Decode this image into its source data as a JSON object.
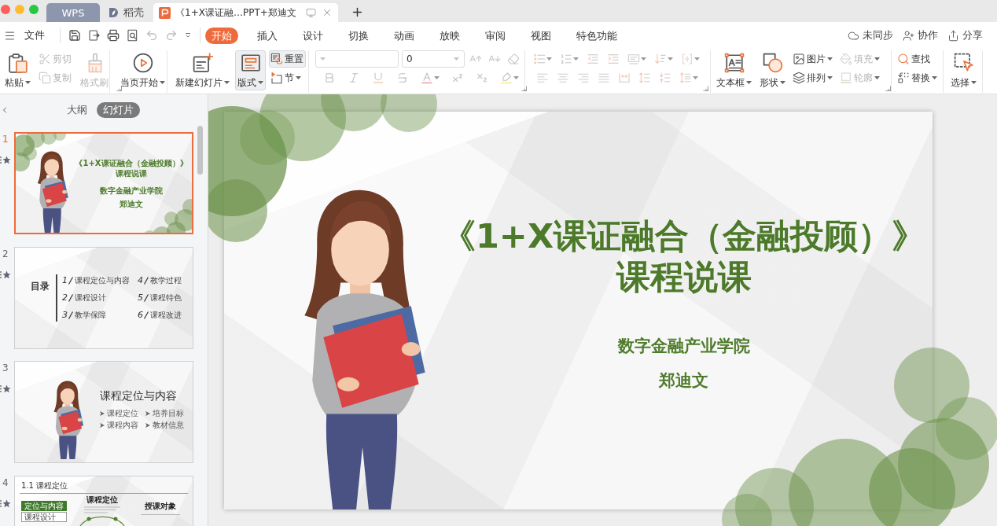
{
  "tabs": [
    {
      "kind": "home",
      "label": "WPS",
      "selected": false
    },
    {
      "kind": "store",
      "label": "稻壳",
      "selected": false
    },
    {
      "kind": "document",
      "label": "《1+X课证融…PPT+郑迪文",
      "selected": true
    }
  ],
  "file_menu": {
    "label": "文件"
  },
  "quick_access": [
    {
      "disabled": false
    },
    {
      "disabled": false
    },
    {
      "disabled": false
    },
    {
      "disabled": false
    },
    {
      "disabled": true
    },
    {
      "disabled": true
    },
    {
      "disabled": false
    }
  ],
  "menu_tabs": [
    {
      "label": "开始",
      "selected": true
    },
    {
      "label": "插入",
      "selected": false
    },
    {
      "label": "设计",
      "selected": false
    },
    {
      "label": "切换",
      "selected": false
    },
    {
      "label": "动画",
      "selected": false
    },
    {
      "label": "放映",
      "selected": false
    },
    {
      "label": "审阅",
      "selected": false
    },
    {
      "label": "视图",
      "selected": false
    },
    {
      "label": "特色功能",
      "selected": false
    }
  ],
  "account_actions": [
    {
      "label": "未同步"
    },
    {
      "label": "协作"
    },
    {
      "label": "分享"
    }
  ],
  "ribbon": [
    {
      "kind": "columns",
      "launcher": true,
      "columns": [
        [
          {
            "kind": "large",
            "label": "粘贴",
            "dropdown": true,
            "disabled": false,
            "highlighted": false
          }
        ],
        [
          {
            "kind": "small",
            "label": "剪切",
            "dropdown": false,
            "disabled": true,
            "highlighted": false
          },
          {
            "kind": "small",
            "label": "复制",
            "dropdown": false,
            "disabled": true,
            "highlighted": false
          }
        ],
        [
          {
            "kind": "large",
            "label": "格式刷",
            "dropdown": false,
            "disabled": true,
            "highlighted": false
          }
        ]
      ]
    },
    {
      "kind": "columns",
      "launcher": false,
      "columns": [
        [
          {
            "kind": "large",
            "label": "当页开始",
            "dropdown": true,
            "disabled": false,
            "highlighted": false
          }
        ]
      ]
    },
    {
      "kind": "columns",
      "launcher": false,
      "columns": [
        [
          {
            "kind": "large",
            "label": "新建幻灯片",
            "dropdown": true,
            "disabled": false,
            "highlighted": false
          }
        ],
        [
          {
            "kind": "large",
            "label": "版式",
            "dropdown": true,
            "disabled": false,
            "highlighted": true
          }
        ],
        [
          {
            "kind": "small",
            "label": "重置",
            "dropdown": false,
            "disabled": false,
            "highlighted": true
          },
          {
            "kind": "small",
            "label": "节",
            "dropdown": true,
            "disabled": false,
            "highlighted": false
          }
        ]
      ]
    },
    {
      "kind": "rows",
      "launcher": true,
      "rows": [
        [
          {
            "kind": "combo",
            "dropdown": true,
            "disabled": false,
            "highlighted": false
          },
          {
            "kind": "combo",
            "value": "0",
            "dropdown": true,
            "disabled": false,
            "highlighted": false
          },
          {
            "kind": "icon",
            "dropdown": false,
            "disabled": true,
            "highlighted": false
          },
          {
            "kind": "icon",
            "dropdown": false,
            "disabled": true,
            "highlighted": false
          },
          {
            "kind": "icon",
            "dropdown": false,
            "disabled": true,
            "highlighted": false
          }
        ],
        [
          {
            "kind": "icon",
            "dropdown": false,
            "disabled": true,
            "highlighted": false
          },
          {
            "kind": "icon",
            "dropdown": false,
            "disabled": true,
            "highlighted": false
          },
          {
            "kind": "icon",
            "dropdown": false,
            "disabled": true,
            "highlighted": false
          },
          {
            "kind": "icon",
            "dropdown": false,
            "disabled": true,
            "highlighted": false
          },
          {
            "kind": "icon",
            "dropdown": true,
            "disabled": true,
            "highlighted": false
          },
          {
            "kind": "icon",
            "dropdown": false,
            "disabled": true,
            "highlighted": false
          },
          {
            "kind": "icon",
            "dropdown": false,
            "disabled": true,
            "highlighted": false
          },
          {
            "kind": "icon",
            "dropdown": true,
            "disabled": true,
            "highlighted": false
          }
        ]
      ]
    },
    {
      "kind": "rows",
      "launcher": true,
      "rows": [
        [
          {
            "kind": "icon",
            "dropdown": true,
            "disabled": true,
            "highlighted": false
          },
          {
            "kind": "icon",
            "dropdown": true,
            "disabled": true,
            "highlighted": false
          },
          {
            "kind": "icon",
            "dropdown": false,
            "disabled": true,
            "highlighted": false
          },
          {
            "kind": "icon",
            "dropdown": false,
            "disabled": true,
            "highlighted": false
          },
          {
            "kind": "icon",
            "dropdown": true,
            "disabled": true,
            "highlighted": false
          },
          {
            "kind": "icon",
            "dropdown": true,
            "disabled": true,
            "highlighted": false
          },
          {
            "kind": "icon",
            "dropdown": true,
            "disabled": true,
            "highlighted": false
          }
        ],
        [
          {
            "kind": "icon",
            "dropdown": false,
            "disabled": true,
            "highlighted": false
          },
          {
            "kind": "icon",
            "dropdown": false,
            "disabled": true,
            "highlighted": false
          },
          {
            "kind": "icon",
            "dropdown": false,
            "disabled": true,
            "highlighted": false
          },
          {
            "kind": "icon",
            "dropdown": false,
            "disabled": true,
            "highlighted": false
          },
          {
            "kind": "icon",
            "dropdown": false,
            "disabled": true,
            "highlighted": false
          },
          {
            "kind": "icon",
            "dropdown": false,
            "disabled": true,
            "highlighted": false
          },
          {
            "kind": "icon",
            "dropdown": false,
            "disabled": true,
            "highlighted": false
          },
          {
            "kind": "icon",
            "dropdown": true,
            "disabled": true,
            "highlighted": false
          }
        ]
      ]
    },
    {
      "kind": "columns",
      "launcher": true,
      "columns": [
        [
          {
            "kind": "large",
            "label": "文本框",
            "dropdown": true,
            "disabled": false,
            "highlighted": false
          }
        ],
        [
          {
            "kind": "large",
            "label": "形状",
            "dropdown": true,
            "disabled": false,
            "highlighted": false
          }
        ],
        [
          {
            "kind": "small",
            "label": "图片",
            "dropdown": true,
            "disabled": false,
            "highlighted": false
          },
          {
            "kind": "small",
            "label": "排列",
            "dropdown": true,
            "disabled": false,
            "highlighted": false
          }
        ],
        [
          {
            "kind": "small",
            "label": "填充",
            "dropdown": true,
            "disabled": true,
            "highlighted": false
          },
          {
            "kind": "small",
            "label": "轮廓",
            "dropdown": true,
            "disabled": true,
            "highlighted": false
          }
        ]
      ]
    },
    {
      "kind": "columns",
      "launcher": false,
      "columns": [
        [
          {
            "kind": "small",
            "label": "查找",
            "dropdown": false,
            "disabled": false,
            "highlighted": false
          },
          {
            "kind": "small",
            "label": "替换",
            "dropdown": true,
            "disabled": false,
            "highlighted": false
          }
        ]
      ]
    },
    {
      "kind": "columns",
      "launcher": false,
      "columns": [
        [
          {
            "kind": "large",
            "label": "选择",
            "dropdown": true,
            "disabled": false,
            "highlighted": false
          }
        ]
      ]
    }
  ],
  "outline_tabs": [
    {
      "label": "大纲",
      "selected": false
    },
    {
      "label": "幻灯片",
      "selected": true
    }
  ],
  "slides": [
    {
      "number": "1",
      "selected": true,
      "kind": "title",
      "title": "《1+X课证融合（金融投顾）》",
      "subtitle": "课程说课",
      "org": "数字金融产业学院",
      "author": "郑迪文"
    },
    {
      "number": "2",
      "selected": false,
      "kind": "toc",
      "heading": "目录",
      "items": [
        {
          "number": "1",
          "label": "课程定位与内容"
        },
        {
          "number": "2",
          "label": "课程设计"
        },
        {
          "number": "3",
          "label": "教学保障"
        },
        {
          "number": "4",
          "label": "教学过程"
        },
        {
          "number": "5",
          "label": "课程特色"
        },
        {
          "number": "6",
          "label": "课程改进"
        }
      ]
    },
    {
      "number": "3",
      "selected": false,
      "kind": "section",
      "title": "课程定位与内容",
      "bullets": [
        "课程定位",
        "培养目标",
        "课程内容",
        "教材信息"
      ]
    },
    {
      "number": "4",
      "selected": false,
      "kind": "content",
      "heading": "1.1 课程定位",
      "nav": [
        {
          "label": "定位与内容",
          "selected": true
        },
        {
          "label": "课程设计",
          "selected": false
        }
      ],
      "blocks": [
        "课程定位",
        "授课对象"
      ]
    }
  ],
  "slide": {
    "title": "《1+X课证融合（金融投顾）》",
    "subtitle": "课程说课",
    "org": "数字金融产业学院",
    "author": "郑迪文"
  }
}
